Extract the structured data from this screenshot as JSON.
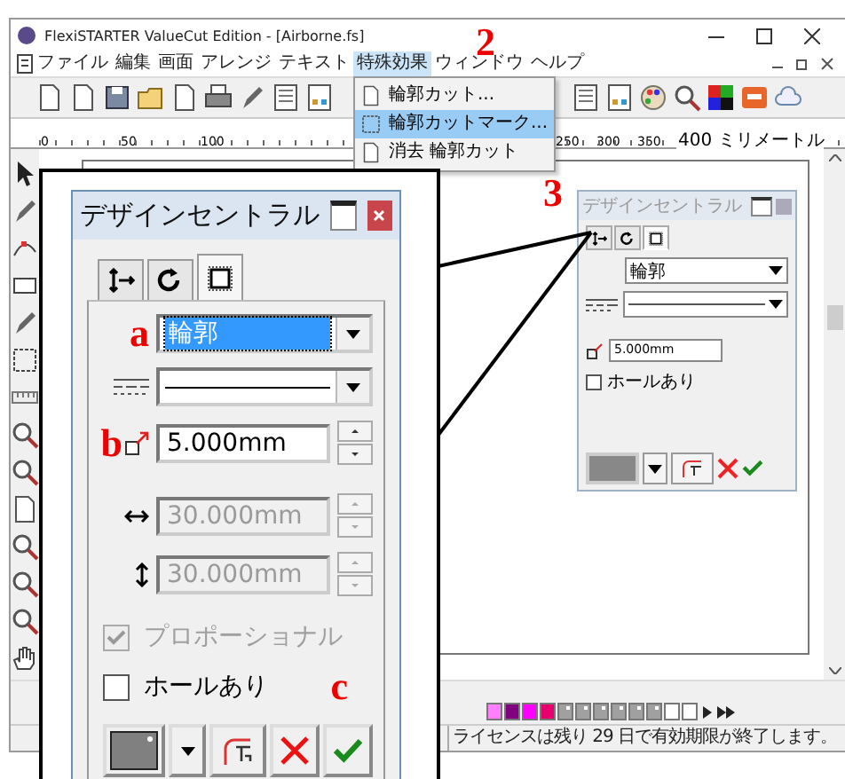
{
  "window": {
    "title": "FlexiSTARTER ValueCut Edition - [Airborne.fs]"
  },
  "menu": [
    {
      "label": "ファイル",
      "selected": false
    },
    {
      "label": "編集",
      "selected": false
    },
    {
      "label": "画面",
      "selected": false
    },
    {
      "label": "アレンジ",
      "selected": false
    },
    {
      "label": "テキスト",
      "selected": false
    },
    {
      "label": "特殊効果",
      "selected": true
    },
    {
      "label": "ウィンドウ",
      "selected": false
    },
    {
      "label": "ヘルプ",
      "selected": false
    }
  ],
  "open_menu": [
    {
      "label": "輪郭カット...",
      "selected": false
    },
    {
      "label": "輪郭カットマーク...",
      "selected": true
    },
    {
      "label": "消去 輪郭カット",
      "selected": false
    }
  ],
  "ruler": [
    "0",
    "50",
    "100",
    "250",
    "300",
    "350",
    "400 ミリメートル"
  ],
  "step_numbers": [
    "2",
    "3"
  ],
  "small_panel": {
    "title": "デザインセントラル",
    "tabs": [
      {
        "selected": false
      },
      {
        "selected": false
      },
      {
        "selected": true
      }
    ],
    "outline": "輪郭",
    "size": "5.000mm",
    "hole": {
      "label": "ホールあり",
      "checked": false
    }
  },
  "callout": {
    "title": "デザインセントラル",
    "tabs": [
      {
        "selected": false
      },
      {
        "selected": false
      },
      {
        "selected": true
      }
    ],
    "markers": [
      "a",
      "b",
      "c"
    ],
    "outline": {
      "value": "輪郭",
      "highlighted": true
    },
    "size": {
      "value": "5.000mm",
      "disabled": false
    },
    "width": {
      "value": "30.000mm",
      "disabled": true
    },
    "height": {
      "value": "30.000mm",
      "disabled": true
    },
    "proportional": {
      "label": "プロポーショナル",
      "checked": true,
      "disabled": true
    },
    "hole": {
      "label": "ホールあり",
      "checked": false,
      "disabled": false
    }
  },
  "palette": [
    {
      "color": "#ff80ff"
    },
    {
      "color": "#800080"
    },
    {
      "color": "#ff00ff"
    },
    {
      "color": "#e6006e"
    },
    {
      "color": "#a0a0a0"
    },
    {
      "color": "#a0a0a0"
    },
    {
      "color": "#a0a0a0"
    },
    {
      "color": "#a0a0a0"
    },
    {
      "color": "#a0a0a0"
    },
    {
      "color": "#a0a0a0"
    },
    {
      "color": "#ffffff"
    },
    {
      "color": "#ffffff"
    }
  ],
  "status_bar": "ライセンスは残り 29 日で有効期限が終了します。"
}
